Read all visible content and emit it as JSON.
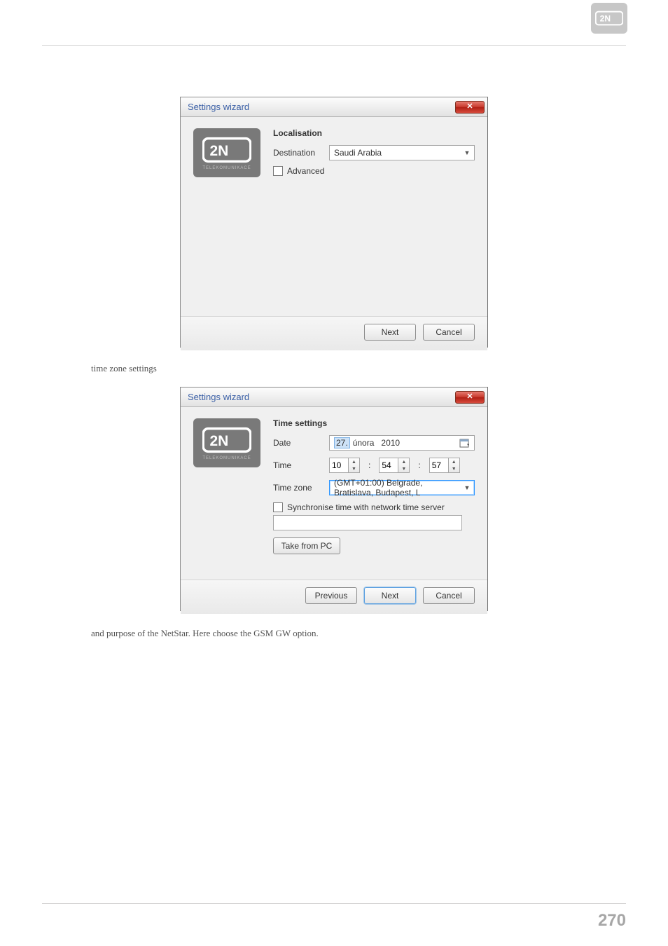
{
  "page_number": "270",
  "caption_timezone": "time zone settings",
  "caption_purpose": "and purpose of the NetStar. Here choose the GSM GW option.",
  "dialog1": {
    "title": "Settings wizard",
    "section": "Localisation",
    "dest_label": "Destination",
    "dest_value": "Saudi Arabia",
    "adv_label": "Advanced",
    "next": "Next",
    "cancel": "Cancel",
    "logo_sub": "TELEKOMUNIKACE"
  },
  "dialog2": {
    "title": "Settings wizard",
    "section": "Time settings",
    "date_label": "Date",
    "date_day": "27.",
    "date_month": "února",
    "date_year": "2010",
    "time_label": "Time",
    "time_h": "10",
    "time_m": "54",
    "time_s": "57",
    "tz_label": "Time zone",
    "tz_value": "(GMT+01:00) Belgrade, Bratislava, Budapest, L",
    "sync_label": "Synchronise time with network time server",
    "take_pc": "Take from PC",
    "prev": "Previous",
    "next": "Next",
    "cancel": "Cancel",
    "logo_sub": "TELEKOMUNIKACE"
  }
}
